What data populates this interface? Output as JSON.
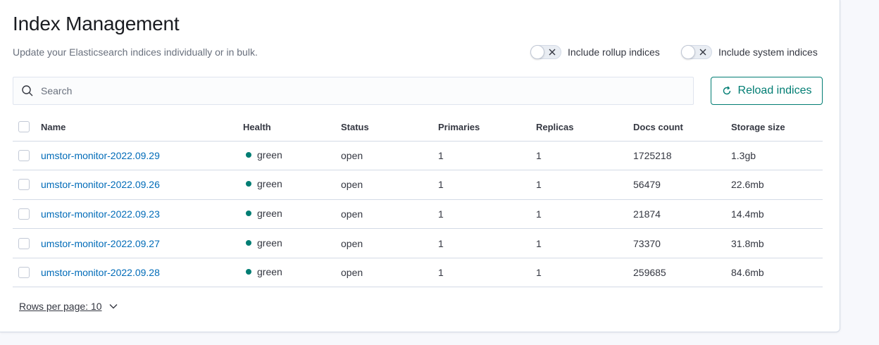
{
  "header": {
    "title": "Index Management",
    "subtitle": "Update your Elasticsearch indices individually or in bulk."
  },
  "toggles": {
    "rollup_label": "Include rollup indices",
    "rollup_checked": false,
    "system_label": "Include system indices",
    "system_checked": false
  },
  "search": {
    "placeholder": "Search",
    "value": ""
  },
  "reload_button": {
    "label": "Reload indices"
  },
  "table": {
    "columns": [
      "Name",
      "Health",
      "Status",
      "Primaries",
      "Replicas",
      "Docs count",
      "Storage size"
    ],
    "rows": [
      {
        "name": "umstor-monitor-2022.09.29",
        "health": "green",
        "status": "open",
        "primaries": "1",
        "replicas": "1",
        "docs_count": "1725218",
        "storage_size": "1.3gb"
      },
      {
        "name": "umstor-monitor-2022.09.26",
        "health": "green",
        "status": "open",
        "primaries": "1",
        "replicas": "1",
        "docs_count": "56479",
        "storage_size": "22.6mb"
      },
      {
        "name": "umstor-monitor-2022.09.23",
        "health": "green",
        "status": "open",
        "primaries": "1",
        "replicas": "1",
        "docs_count": "21874",
        "storage_size": "14.4mb"
      },
      {
        "name": "umstor-monitor-2022.09.27",
        "health": "green",
        "status": "open",
        "primaries": "1",
        "replicas": "1",
        "docs_count": "73370",
        "storage_size": "31.8mb"
      },
      {
        "name": "umstor-monitor-2022.09.28",
        "health": "green",
        "status": "open",
        "primaries": "1",
        "replicas": "1",
        "docs_count": "259685",
        "storage_size": "84.6mb"
      }
    ]
  },
  "pagination": {
    "rows_per_page_label": "Rows per page: 10"
  },
  "colors": {
    "accent": "#017d73",
    "link": "#006bb8",
    "health_green": "#017d73"
  },
  "icons": {
    "search": "search-icon",
    "reload": "refresh-icon",
    "toggle_off": "cross-icon",
    "pager": "chevron-down-icon"
  }
}
